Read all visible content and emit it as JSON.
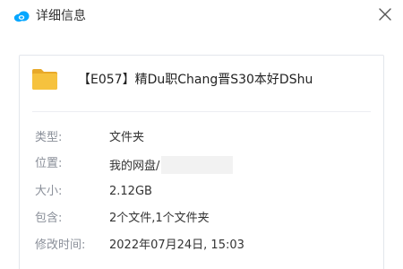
{
  "dialog": {
    "title": "详细信息",
    "file_name": "【E057】精Du职Chang晋S30本好DShu",
    "rows": [
      {
        "label": "类型:",
        "value": "文件夹"
      },
      {
        "label": "位置:",
        "value": "我的网盘/"
      },
      {
        "label": "大小:",
        "value": "2.12GB"
      },
      {
        "label": "包含:",
        "value": "2个文件,1个文件夹"
      },
      {
        "label": "修改时间:",
        "value": "2022年07月24日, 15:03"
      }
    ]
  },
  "icons": {
    "app": "cloud-icon",
    "close": "close-icon",
    "file": "folder-icon"
  },
  "colors": {
    "accent": "#06a7ff",
    "folder": "#f6c23e",
    "label": "#8a8f99",
    "value": "#333333"
  }
}
